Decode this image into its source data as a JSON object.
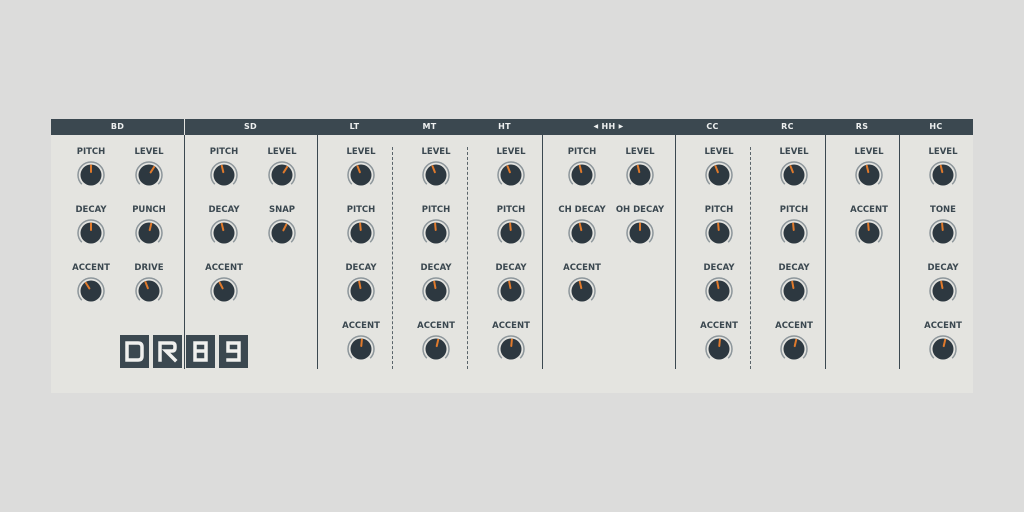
{
  "sections": [
    {
      "id": "bd",
      "name": "BD"
    },
    {
      "id": "sd",
      "name": "SD"
    },
    {
      "id": "lt",
      "name": "LT"
    },
    {
      "id": "mt",
      "name": "MT"
    },
    {
      "id": "ht",
      "name": "HT"
    },
    {
      "id": "hh",
      "name": "HH"
    },
    {
      "id": "cc",
      "name": "CC"
    },
    {
      "id": "rc",
      "name": "RC"
    },
    {
      "id": "rs",
      "name": "RS"
    },
    {
      "id": "hc",
      "name": "HC"
    }
  ],
  "knobs": {
    "bd": [
      {
        "label": "PITCH",
        "value": 0.5
      },
      {
        "label": "LEVEL",
        "value": 0.62
      },
      {
        "label": "DECAY",
        "value": 0.5
      },
      {
        "label": "PUNCH",
        "value": 0.55
      },
      {
        "label": "ACCENT",
        "value": 0.38
      },
      {
        "label": "DRIVE",
        "value": 0.42
      }
    ],
    "sd": [
      {
        "label": "PITCH",
        "value": 0.45
      },
      {
        "label": "LEVEL",
        "value": 0.62
      },
      {
        "label": "DECAY",
        "value": 0.45
      },
      {
        "label": "SNAP",
        "value": 0.6
      },
      {
        "label": "ACCENT",
        "value": 0.4
      }
    ],
    "lt": [
      {
        "label": "LEVEL",
        "value": 0.42
      },
      {
        "label": "PITCH",
        "value": 0.48
      },
      {
        "label": "DECAY",
        "value": 0.46
      },
      {
        "label": "ACCENT",
        "value": 0.52
      }
    ],
    "mt": [
      {
        "label": "LEVEL",
        "value": 0.42
      },
      {
        "label": "PITCH",
        "value": 0.48
      },
      {
        "label": "DECAY",
        "value": 0.46
      },
      {
        "label": "ACCENT",
        "value": 0.55
      }
    ],
    "ht": [
      {
        "label": "LEVEL",
        "value": 0.42
      },
      {
        "label": "PITCH",
        "value": 0.48
      },
      {
        "label": "DECAY",
        "value": 0.46
      },
      {
        "label": "ACCENT",
        "value": 0.52
      }
    ],
    "hh": [
      {
        "label": "PITCH",
        "value": 0.45
      },
      {
        "label": "LEVEL",
        "value": 0.45
      },
      {
        "label": "CH DECAY",
        "value": 0.45
      },
      {
        "label": "OH DECAY",
        "value": 0.5
      },
      {
        "label": "ACCENT",
        "value": 0.45
      }
    ],
    "cc": [
      {
        "label": "LEVEL",
        "value": 0.42
      },
      {
        "label": "PITCH",
        "value": 0.48
      },
      {
        "label": "DECAY",
        "value": 0.46
      },
      {
        "label": "ACCENT",
        "value": 0.52
      }
    ],
    "rc": [
      {
        "label": "LEVEL",
        "value": 0.42
      },
      {
        "label": "PITCH",
        "value": 0.48
      },
      {
        "label": "DECAY",
        "value": 0.46
      },
      {
        "label": "ACCENT",
        "value": 0.55
      }
    ],
    "rs": [
      {
        "label": "LEVEL",
        "value": 0.45
      },
      {
        "label": "ACCENT",
        "value": 0.48
      }
    ],
    "hc": [
      {
        "label": "LEVEL",
        "value": 0.45
      },
      {
        "label": "TONE",
        "value": 0.48
      },
      {
        "label": "DECAY",
        "value": 0.46
      },
      {
        "label": "ACCENT",
        "value": 0.55
      }
    ]
  },
  "logo": {
    "text": "DR89"
  },
  "colors": {
    "header": "#3b4850",
    "panel": "#e4e4e0",
    "background": "#dcdcdb",
    "knob": "#2d3840",
    "indicator": "#e07a2c",
    "label": "#3b4850"
  }
}
